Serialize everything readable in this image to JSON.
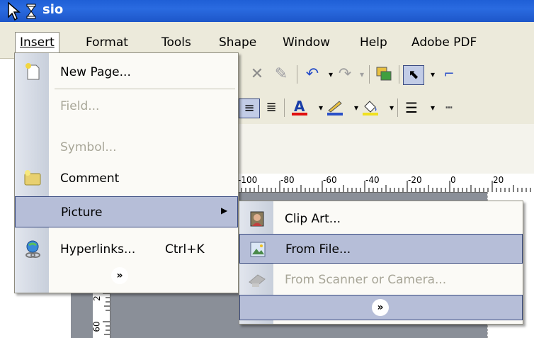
{
  "window": {
    "title": "sio"
  },
  "menubar": {
    "items": [
      {
        "label": "Insert",
        "mnemonic": "I"
      },
      {
        "label": "Format",
        "mnemonic": "o"
      },
      {
        "label": "Tools",
        "mnemonic": "T"
      },
      {
        "label": "Shape",
        "mnemonic": "S"
      },
      {
        "label": "Window",
        "mnemonic": "W"
      },
      {
        "label": "Help",
        "mnemonic": "H"
      },
      {
        "label": "Adobe PDF",
        "mnemonic": "b"
      }
    ]
  },
  "insert_menu": {
    "items": [
      {
        "label": "New Page...",
        "enabled": true,
        "icon": "new-page-icon"
      },
      {
        "label": "Field...",
        "enabled": false
      },
      {
        "label": "Symbol...",
        "enabled": false
      },
      {
        "label": "Comment",
        "enabled": true,
        "icon": "comment-icon"
      },
      {
        "label": "Picture",
        "enabled": true,
        "highlighted": true,
        "has_submenu": true
      },
      {
        "label": "Hyperlinks...",
        "enabled": true,
        "shortcut": "Ctrl+K",
        "icon": "hyperlink-icon"
      }
    ],
    "expand_glyph": "»"
  },
  "picture_submenu": {
    "items": [
      {
        "label": "Clip Art...",
        "enabled": true,
        "icon": "clip-art-icon"
      },
      {
        "label": "From File...",
        "enabled": true,
        "highlighted": true,
        "icon": "picture-file-icon"
      },
      {
        "label": "From Scanner or Camera...",
        "enabled": false,
        "icon": "scanner-icon"
      }
    ],
    "expand_glyph": "»"
  },
  "ruler": {
    "labels": [
      "-100",
      "-80",
      "-60",
      "-40",
      "-20",
      "0",
      "20"
    ],
    "vertical_labels": [
      "2",
      "60"
    ]
  },
  "colors": {
    "titlebar": "#2a6be0",
    "menubar": "#eceadb",
    "highlight_fill": "#b6bed8",
    "highlight_border": "#3b4c82",
    "disabled_text": "#a8a698",
    "font_color_red": "#e01010",
    "fill_color_yellow": "#f0e020"
  }
}
